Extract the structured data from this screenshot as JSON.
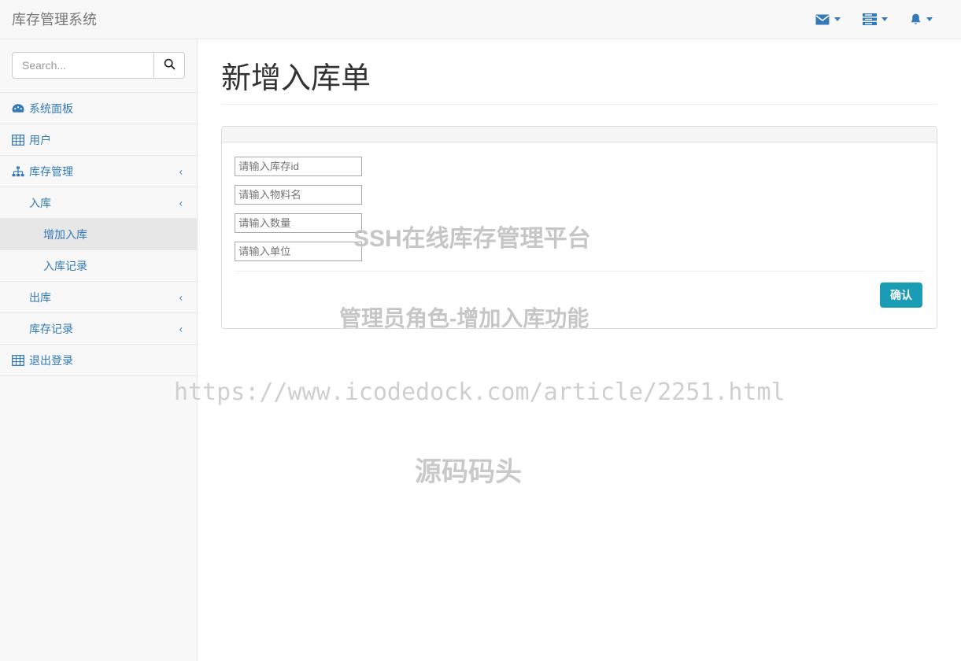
{
  "navbar": {
    "brand": "库存管理系统",
    "items": [
      {
        "icon": "envelope-icon",
        "name": "messages-dropdown"
      },
      {
        "icon": "tasks-icon",
        "name": "tasks-dropdown"
      },
      {
        "icon": "bell-icon",
        "name": "alerts-dropdown"
      }
    ]
  },
  "sidebar": {
    "search": {
      "placeholder": "Search...",
      "value": "",
      "button_icon": "search-icon"
    },
    "items": [
      {
        "label": "系统面板",
        "icon": "dashboard-icon",
        "level": 1,
        "chevron": false,
        "active": false
      },
      {
        "label": "用户",
        "icon": "table-icon",
        "level": 1,
        "chevron": false,
        "active": false
      },
      {
        "label": "库存管理",
        "icon": "sitemap-icon",
        "level": 1,
        "chevron": true,
        "active": false
      },
      {
        "label": "入库",
        "icon": "",
        "level": 2,
        "chevron": true,
        "active": false
      },
      {
        "label": "增加入库",
        "icon": "",
        "level": 3,
        "chevron": false,
        "active": true
      },
      {
        "label": "入库记录",
        "icon": "",
        "level": 3,
        "chevron": false,
        "active": false
      },
      {
        "label": "出库",
        "icon": "",
        "level": 2,
        "chevron": true,
        "active": false
      },
      {
        "label": "库存记录",
        "icon": "",
        "level": 2,
        "chevron": true,
        "active": false
      },
      {
        "label": "退出登录",
        "icon": "table-icon",
        "level": 1,
        "chevron": false,
        "active": false
      }
    ],
    "chevron_glyph": "‹"
  },
  "main": {
    "title": "新增入库单",
    "form": {
      "fields": [
        {
          "name": "inventory-id-input",
          "placeholder": "请输入库存id",
          "value": ""
        },
        {
          "name": "material-name-input",
          "placeholder": "请输入物料名",
          "value": ""
        },
        {
          "name": "quantity-input",
          "placeholder": "请输入数量",
          "value": ""
        },
        {
          "name": "unit-input",
          "placeholder": "请输入单位",
          "value": ""
        }
      ],
      "submit_label": "确认"
    }
  },
  "watermarks": {
    "platform": "SSH在线库存管理平台",
    "role": "管理员角色-增加入库功能",
    "url": "https://www.icodedock.com/article/2251.html",
    "site": "源码码头"
  },
  "colors": {
    "link": "#337ab7",
    "navbar_bg": "#f8f8f8",
    "button": "#1b9cb5",
    "active_item": "#e7e7e7",
    "watermark": "#c6c6c6"
  }
}
